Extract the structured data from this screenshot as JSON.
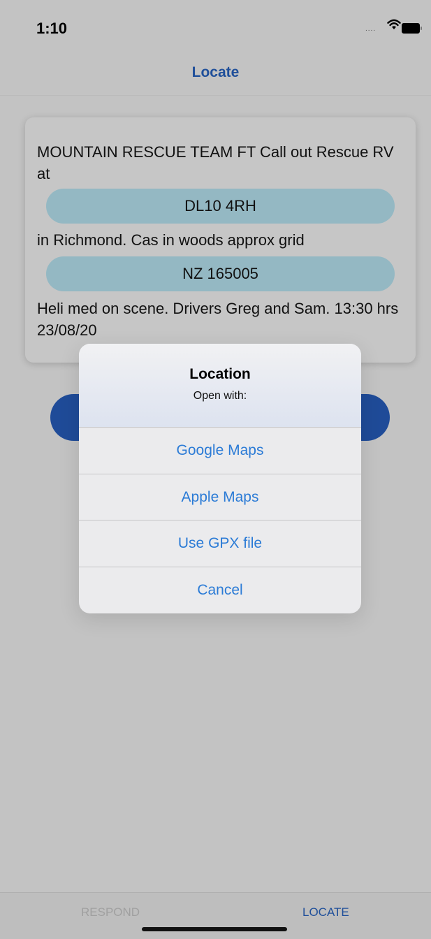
{
  "status_bar": {
    "time": "1:10",
    "signal": "....",
    "icons": [
      "wifi-icon",
      "battery-icon"
    ]
  },
  "nav": {
    "title": "Locate"
  },
  "message": {
    "line1": "MOUNTAIN RESCUE TEAM FT Call out Rescue RV at",
    "postcode": "DL10 4RH",
    "line2": "in Richmond. Cas in woods approx grid",
    "grid_ref": "NZ 165005",
    "line3": "Heli med on scene. Drivers Greg and Sam. 13:30 hrs 23/08/20"
  },
  "alert": {
    "title": "Location",
    "message": "Open with:",
    "actions": [
      "Google Maps",
      "Apple Maps",
      "Use GPX file",
      "Cancel"
    ]
  },
  "tab_bar": {
    "tabs": [
      "RESPOND",
      "LOCATE"
    ],
    "active": "LOCATE"
  },
  "colors": {
    "accent": "#1f4f9a",
    "pill": "#94b8c3",
    "alert_action": "#2b7bd6",
    "inactive_tab": "#a0a0a0"
  }
}
